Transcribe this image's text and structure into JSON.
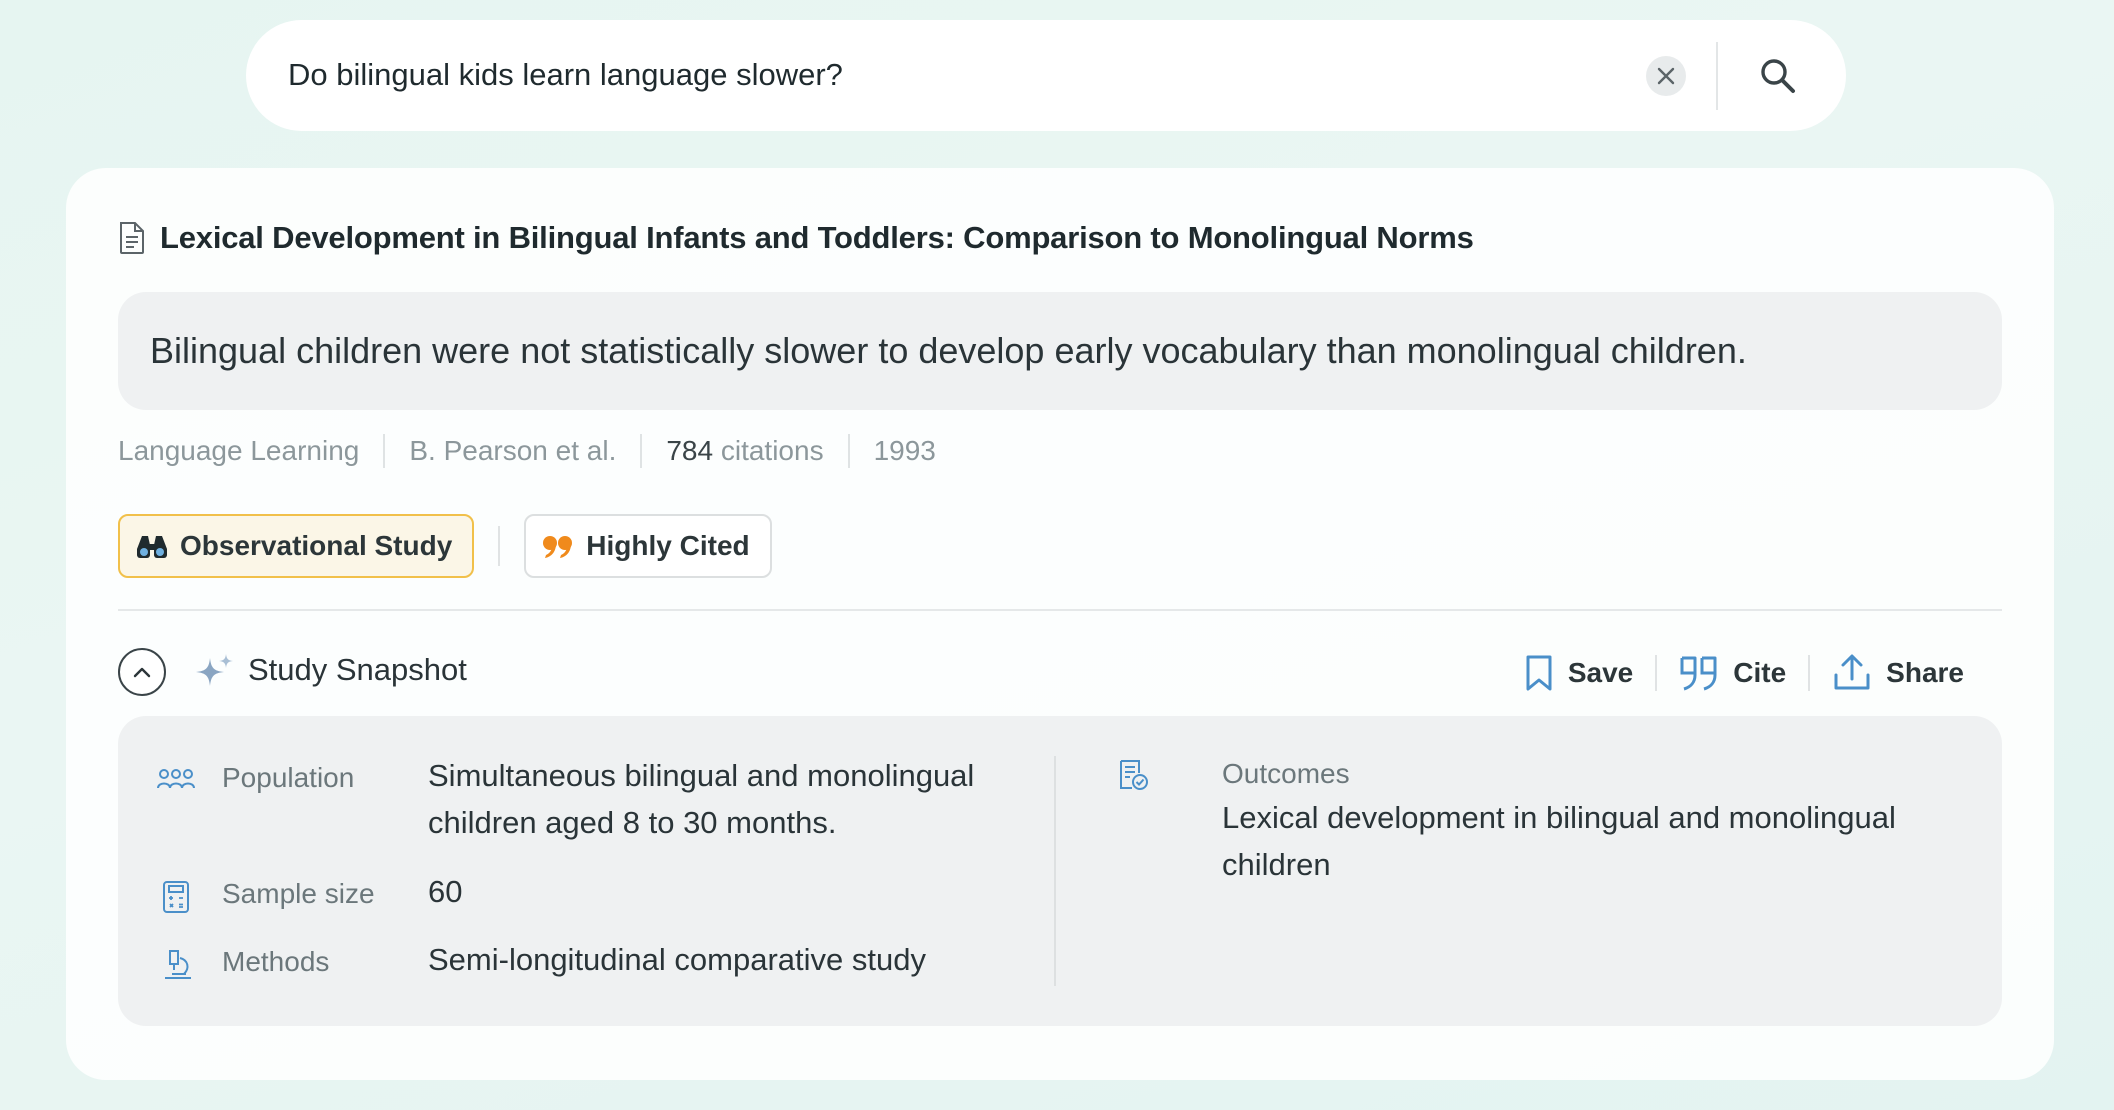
{
  "search": {
    "query": "Do bilingual kids learn language slower?",
    "clear_icon": "close-icon",
    "search_icon": "search-icon"
  },
  "paper": {
    "title": "Lexical Development in Bilingual Infants and Toddlers: Comparison to Monolingual Norms",
    "finding": "Bilingual children were not statistically slower to develop early vocabulary than monolingual children.",
    "journal": "Language Learning",
    "authors": "B. Pearson et al.",
    "citation_count": "784",
    "citations_label": "citations",
    "year": "1993"
  },
  "tags": [
    {
      "label": "Observational Study",
      "icon": "binoculars-icon"
    },
    {
      "label": "Highly Cited",
      "icon": "quote-icon"
    }
  ],
  "snapshot": {
    "title": "Study Snapshot",
    "actions": {
      "save": "Save",
      "cite": "Cite",
      "share": "Share"
    },
    "population_label": "Population",
    "population_value_line1": "Simultaneous bilingual and monolingual",
    "population_value_line2": "children aged 8 to 30 months.",
    "sample_size_label": "Sample size",
    "sample_size_value": "60",
    "methods_label": "Methods",
    "methods_value": "Semi-longitudinal comparative study",
    "outcomes_label": "Outcomes",
    "outcomes_value_line1": "Lexical development in bilingual and monolingual",
    "outcomes_value_line2": "children"
  },
  "colors": {
    "accent_blue": "#4a8fc9",
    "tag_yellow_border": "#f1c04a",
    "quote_orange": "#f08a1c"
  }
}
